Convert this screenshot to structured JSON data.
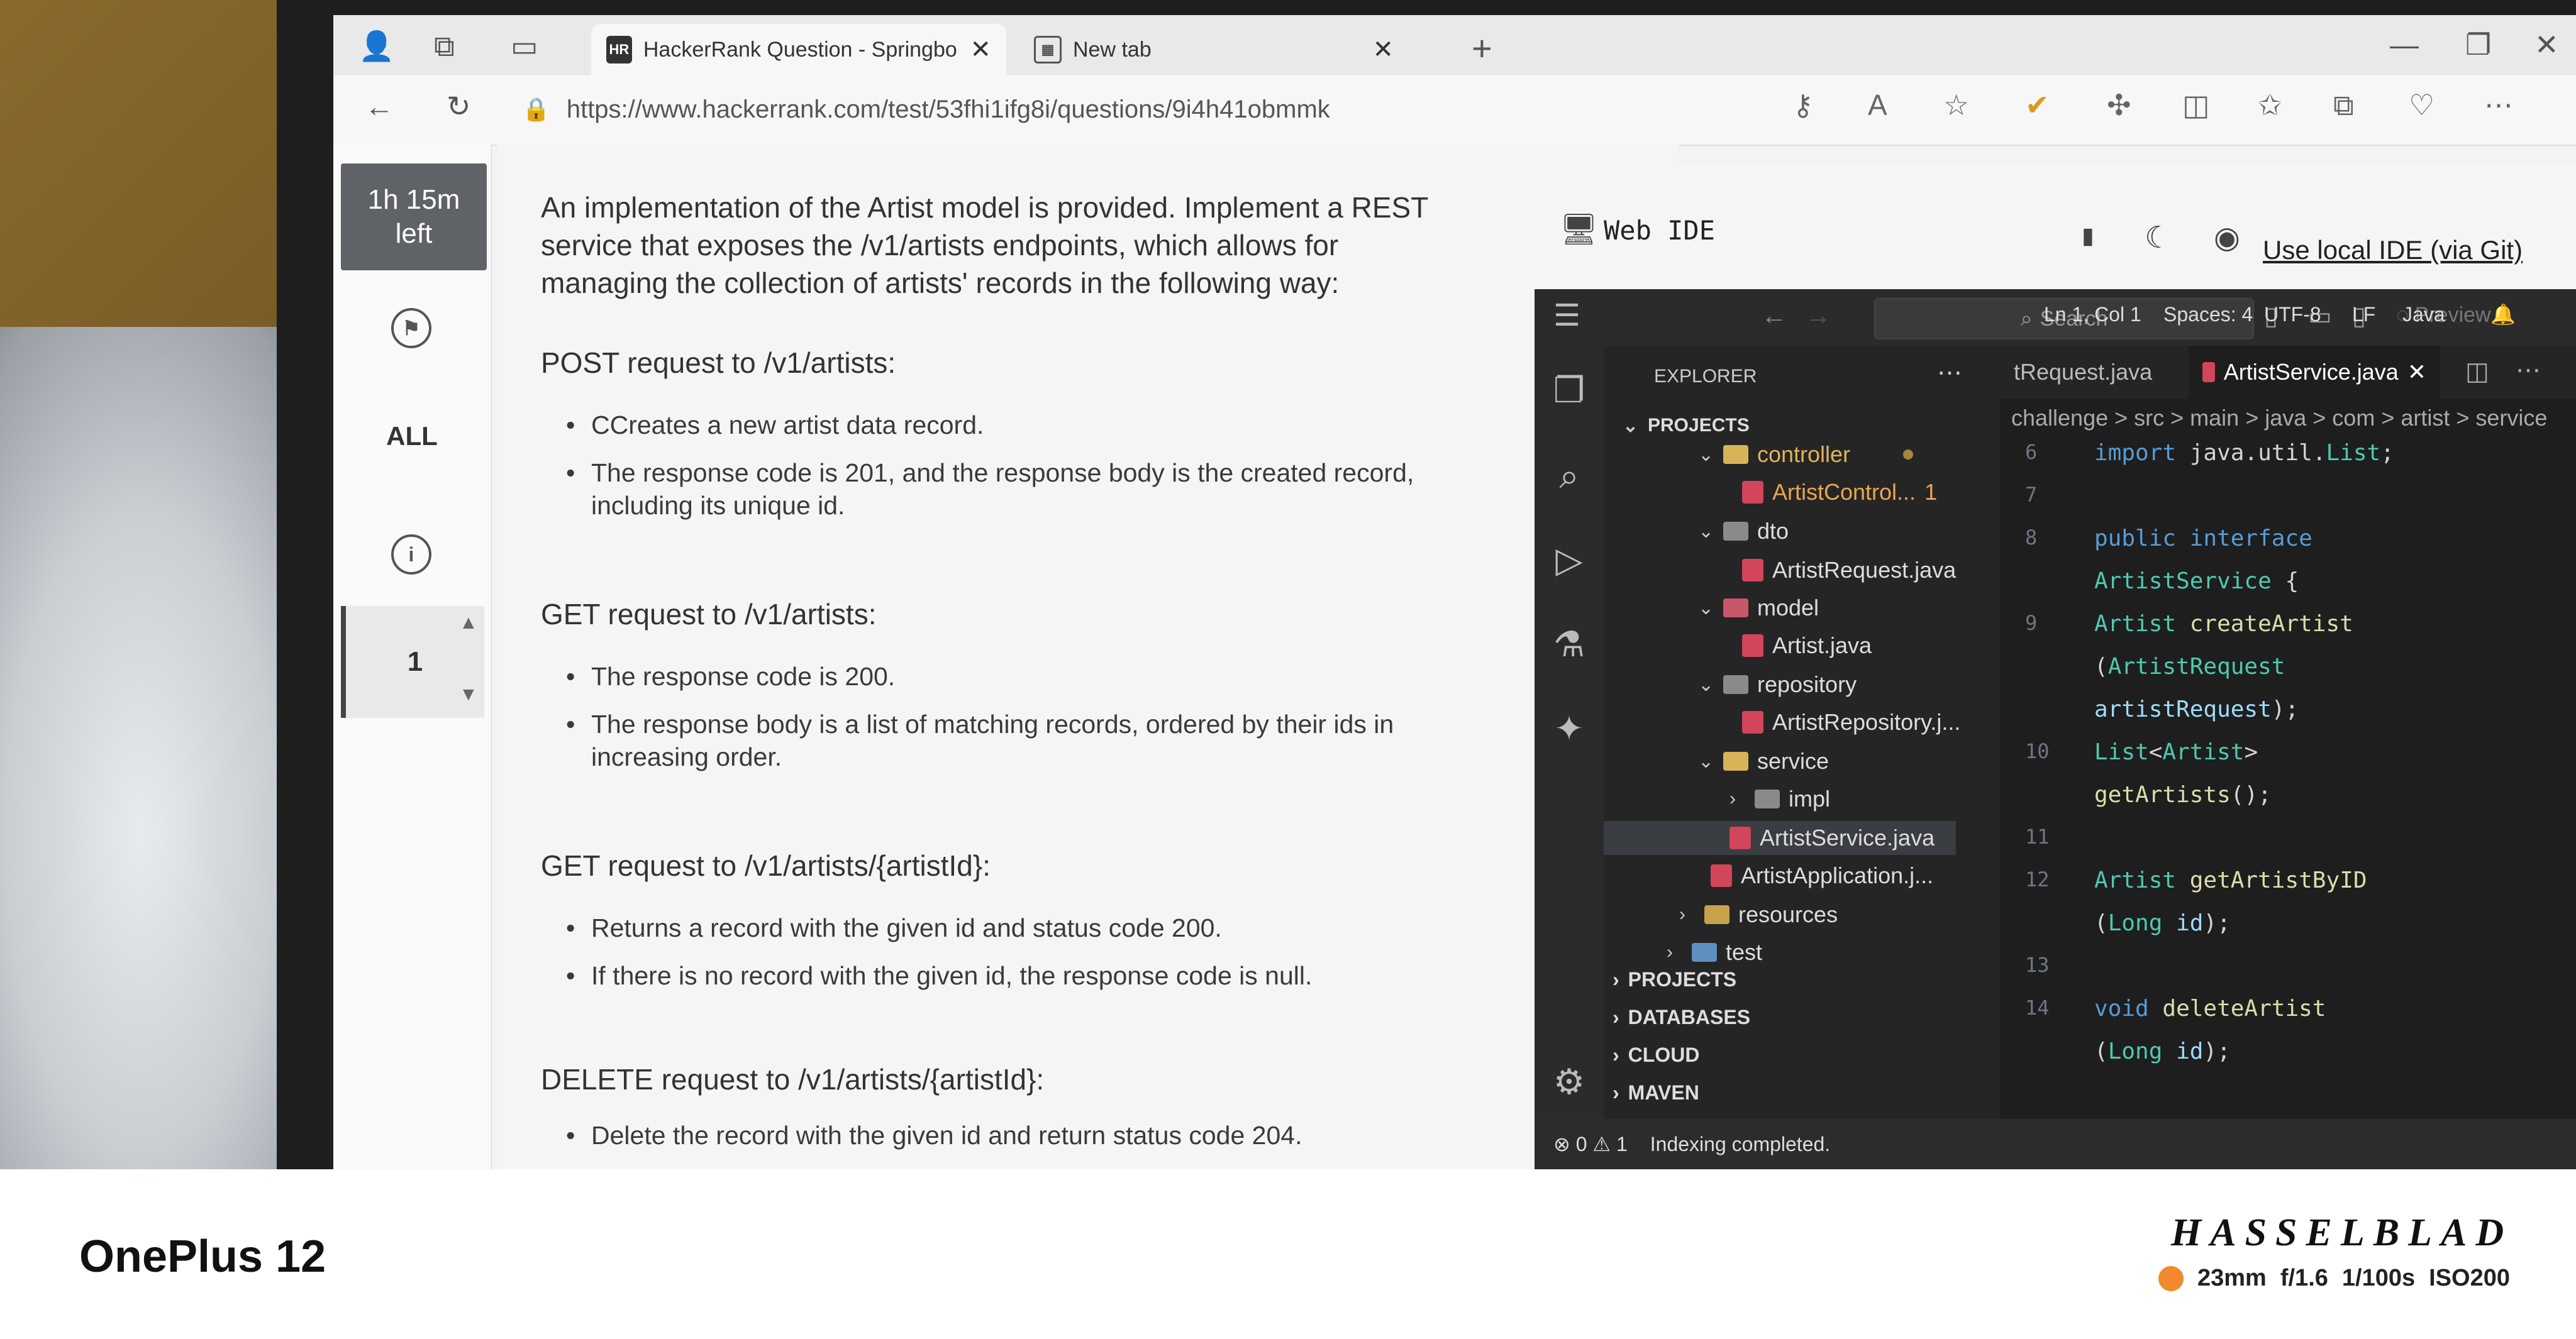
{
  "browser": {
    "tabs": [
      {
        "label": "HackerRank Question - Springbo",
        "favicon": "HR",
        "active": true
      },
      {
        "label": "New tab",
        "active": false
      }
    ],
    "url": "https://www.hackerrank.com/test/53fhi1ifg8i/questions/9i4h41obmmk",
    "icons": [
      "profile-icon",
      "workspaces-icon",
      "tab-actions-icon",
      "back-icon",
      "refresh-icon",
      "lock-icon",
      "key-icon",
      "read-aloud-icon",
      "star-icon",
      "checkmark-extension-icon",
      "extensions-icon",
      "split-screen-icon",
      "favorites-icon",
      "collections-icon",
      "browser-essentials-icon",
      "more-icon"
    ]
  },
  "rail": {
    "timer": [
      "1h 15m",
      "left"
    ],
    "all_label": "ALL",
    "question_number": "1"
  },
  "question": {
    "intro": "An implementation of the Artist model is provided. Implement a REST service that exposes the /v1/artists endpoints, which allows for managing the collection of artists' records in the following way:",
    "sections": [
      {
        "heading": "POST request to /v1/artists:",
        "items": [
          "CCreates a new artist data record.",
          "The response code is 201, and the response body is the created record, including its unique id."
        ]
      },
      {
        "heading": "GET request to /v1/artists:",
        "items": [
          "The response code is 200.",
          "The response body is a list of matching records, ordered by their ids in increasing order."
        ]
      },
      {
        "heading": "GET request to /v1/artists/{artistId}:",
        "items": [
          "Returns a record with the given id and status code 200.",
          "If there is no record with the given id, the response code is null."
        ]
      },
      {
        "heading": "DELETE request to /v1/artists/{artistId}:",
        "items": [
          "Delete the record with the given id and return status code 204."
        ]
      }
    ]
  },
  "ide": {
    "title": "Web IDE",
    "local_ide_link": "Use local IDE (via Git)",
    "search_placeholder": "Search",
    "preview_label": "Preview",
    "explorer_title": "EXPLORER",
    "projects_label": "PROJECTS",
    "tree": [
      {
        "name": "controller",
        "type": "folder-open",
        "level": 2,
        "color": "#e0b35a"
      },
      {
        "name": "ArtistControl...",
        "type": "java",
        "level": 3,
        "badge": "1",
        "color": "#e8a64f"
      },
      {
        "name": "dto",
        "type": "folder-open",
        "level": 2
      },
      {
        "name": "ArtistRequest.java",
        "type": "java",
        "level": 3
      },
      {
        "name": "model",
        "type": "folder-open",
        "level": 2
      },
      {
        "name": "Artist.java",
        "type": "java",
        "level": 3
      },
      {
        "name": "repository",
        "type": "folder-open",
        "level": 2
      },
      {
        "name": "ArtistRepository.j...",
        "type": "java",
        "level": 3
      },
      {
        "name": "service",
        "type": "folder-open",
        "level": 2
      },
      {
        "name": "impl",
        "type": "folder-closed",
        "level": 3
      },
      {
        "name": "ArtistService.java",
        "type": "java",
        "level": 3,
        "selected": true
      },
      {
        "name": "ArtistApplication.j...",
        "type": "java",
        "level": 2
      },
      {
        "name": "resources",
        "type": "folder-closed",
        "level": 1
      },
      {
        "name": "test",
        "type": "folder-closed",
        "level": 1
      }
    ],
    "sections": [
      "PROJECTS",
      "DATABASES",
      "CLOUD",
      "MAVEN"
    ],
    "editor_tabs": [
      {
        "label": "tRequest.java",
        "active": false
      },
      {
        "label": "ArtistService.java",
        "active": true
      }
    ],
    "breadcrumb": "challenge > src > main > java > com > artist > service",
    "code": [
      {
        "ln": "6",
        "text": "import java.util.List;"
      },
      {
        "ln": "7",
        "text": ""
      },
      {
        "ln": "8",
        "text": "public interface"
      },
      {
        "ln": "",
        "text": "ArtistService {"
      },
      {
        "ln": "9",
        "text": "    Artist createArtist"
      },
      {
        "ln": "",
        "text": "    (ArtistRequest"
      },
      {
        "ln": "",
        "text": "    artistRequest);"
      },
      {
        "ln": "10",
        "text": "    List<Artist>"
      },
      {
        "ln": "",
        "text": "    getArtists();"
      },
      {
        "ln": "11",
        "text": ""
      },
      {
        "ln": "12",
        "text": "    Artist getArtistByID"
      },
      {
        "ln": "",
        "text": "    (Long id);"
      },
      {
        "ln": "13",
        "text": ""
      },
      {
        "ln": "14",
        "text": "    void deleteArtist"
      },
      {
        "ln": "",
        "text": "    (Long id);"
      }
    ],
    "status": {
      "errors": "0",
      "warnings": "1",
      "message": "Indexing completed.",
      "position": "Ln 1, Col 1",
      "spaces": "Spaces: 4",
      "encoding": "UTF-8",
      "eol": "LF",
      "language": "Java"
    }
  },
  "footer": {
    "device": "OnePlus 12",
    "brand": "HASSELBLAD",
    "exif": [
      "23mm",
      "f/1.6",
      "1/100s",
      "ISO200"
    ]
  }
}
